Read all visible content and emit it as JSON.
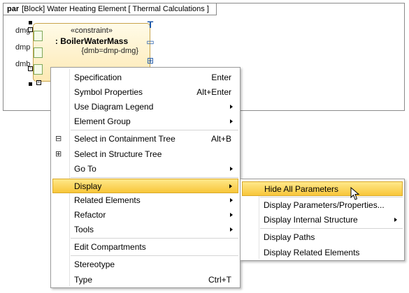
{
  "frame": {
    "keyword": "par",
    "title": "[Block] Water Heating Element [ Thermal Calculations ]"
  },
  "constraint": {
    "stereotype": "«constraint»",
    "name": ": BoilerWaterMass",
    "expression": "{dmb=dmp-dmg}",
    "params": [
      "dmg",
      "dmp",
      "dmb"
    ]
  },
  "context_menu": {
    "items": [
      {
        "label": "Specification",
        "shortcut": "Enter"
      },
      {
        "label": "Symbol Properties",
        "shortcut": "Alt+Enter"
      },
      {
        "label": "Use Diagram Legend",
        "submenu": true
      },
      {
        "label": "Element Group",
        "submenu": true
      },
      {
        "label": "Select in Containment Tree",
        "shortcut": "Alt+B",
        "icon": "containment-tree-icon"
      },
      {
        "label": "Select in Structure Tree",
        "icon": "structure-tree-icon"
      },
      {
        "label": "Go To",
        "submenu": true
      },
      {
        "label": "Display",
        "submenu": true,
        "highlighted": true
      },
      {
        "label": "Related Elements",
        "submenu": true
      },
      {
        "label": "Refactor",
        "submenu": true
      },
      {
        "label": "Tools",
        "submenu": true
      },
      {
        "label": "Edit Compartments"
      },
      {
        "label": "Stereotype"
      },
      {
        "label": "Type",
        "shortcut": "Ctrl+T"
      }
    ]
  },
  "display_submenu": {
    "items": [
      {
        "label": "Hide All Parameters",
        "highlighted": true
      },
      {
        "label": "Display Parameters/Properties..."
      },
      {
        "label": "Display Internal Structure",
        "submenu": true
      },
      {
        "label": "Display Paths"
      },
      {
        "label": "Display Related Elements"
      }
    ]
  },
  "colors": {
    "highlight_top": "#ffe88a",
    "highlight_bottom": "#f8c63a",
    "constraint_fill": "#fde9b4",
    "pin_border": "#7fa85b"
  }
}
